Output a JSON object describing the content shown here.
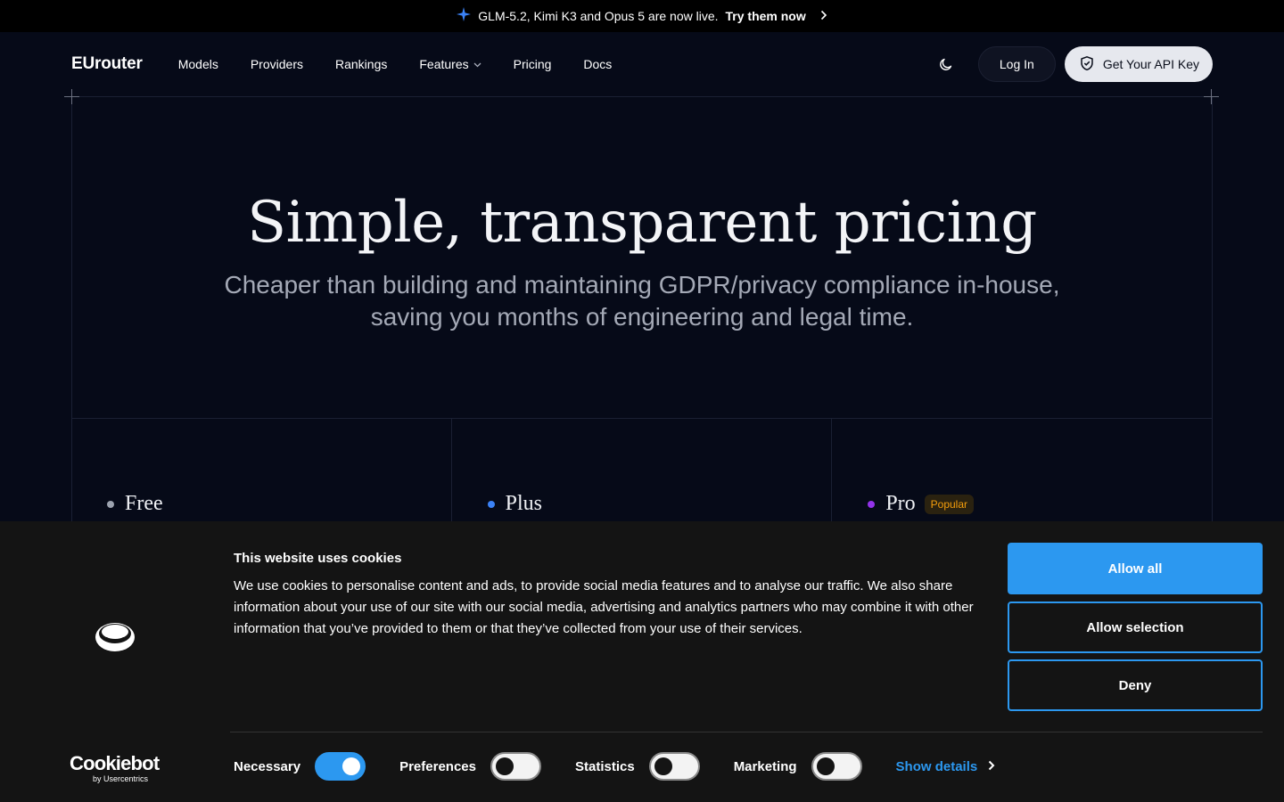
{
  "announcement": {
    "text": "GLM-5.2, Kimi K3 and Opus 5 are now live.",
    "cta": "Try them now"
  },
  "header": {
    "logo": "EUrouter",
    "nav": [
      "Models",
      "Providers",
      "Rankings",
      "Features",
      "Pricing",
      "Docs"
    ],
    "login": "Log In",
    "api_key": "Get Your API Key"
  },
  "hero": {
    "title": "Simple, transparent pricing",
    "subtitle_line1": "Cheaper than building and maintaining GDPR/privacy compliance in-house,",
    "subtitle_line2": "saving you months of engineering and legal time."
  },
  "plans": [
    {
      "name": "Free",
      "dot_color": "#9ca3af"
    },
    {
      "name": "Plus",
      "dot_color": "#3b82f6"
    },
    {
      "name": "Pro",
      "dot_color": "#9333ea",
      "badge": "Popular"
    }
  ],
  "cookie": {
    "title": "This website uses cookies",
    "text": "We use cookies to personalise content and ads, to provide social media features and to analyse our traffic. We also share information about your use of our site with our social media, advertising and analytics partners who may combine it with other information that you’ve provided to them or that they’ve collected from your use of their services.",
    "allow_all": "Allow all",
    "allow_selection": "Allow selection",
    "deny": "Deny",
    "brand": "Cookiebot",
    "brand_sub": "by Usercentrics",
    "toggles": [
      {
        "label": "Necessary",
        "on": true
      },
      {
        "label": "Preferences",
        "on": false
      },
      {
        "label": "Statistics",
        "on": false
      },
      {
        "label": "Marketing",
        "on": false
      }
    ],
    "show_details": "Show details"
  },
  "colors": {
    "accent": "#2c98f0",
    "background": "#060a18",
    "badge": "#f59e0b"
  }
}
